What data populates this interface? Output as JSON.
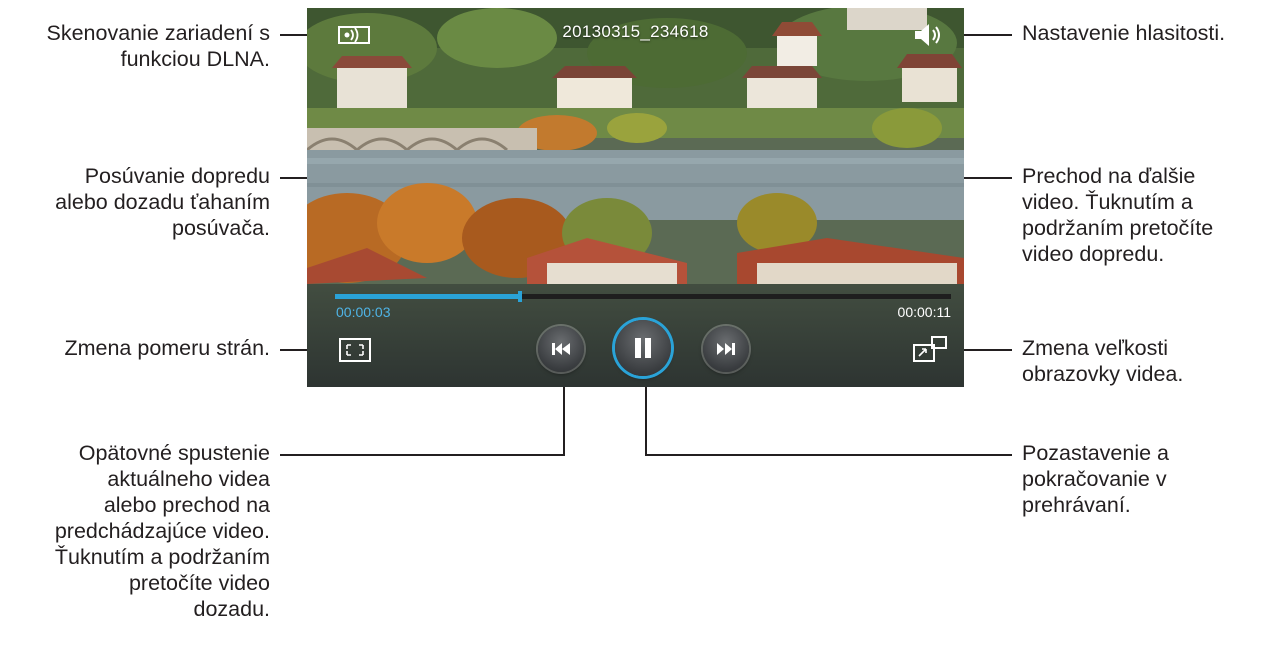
{
  "player": {
    "video_title": "20130315_234618",
    "current_time": "00:00:03",
    "total_time": "00:00:11",
    "progress_fraction": 0.3
  },
  "callouts": {
    "dlna": "Skenovanie zariadení s\nfunkciou DLNA.",
    "seek": "Posúvanie dopredu\nalebo dozadu ťahaním\nposúvača.",
    "aspect": "Zmena pomeru strán.",
    "previous": "Opätovné spustenie\naktuálneho videa\nalebo prechod na\npredchádzajúce video.\nŤuknutím a podržaním\npretočíte video\ndozadu.",
    "volume": "Nastavenie hlasitosti.",
    "next": "Prechod na ďalšie\nvideo. Ťuknutím a\npodržaním pretočíte\nvideo dopredu.",
    "popup": "Zmena veľkosti\nobrazovky videa.",
    "pause": "Pozastavenie a\npokračovanie v\nprehrávaní."
  },
  "colors": {
    "accent": "#2aa3d8",
    "text": "#231f20"
  },
  "icons": [
    "dlna-icon",
    "volume-icon",
    "aspect-ratio-icon",
    "previous-icon",
    "pause-icon",
    "next-icon",
    "popup-icon"
  ]
}
